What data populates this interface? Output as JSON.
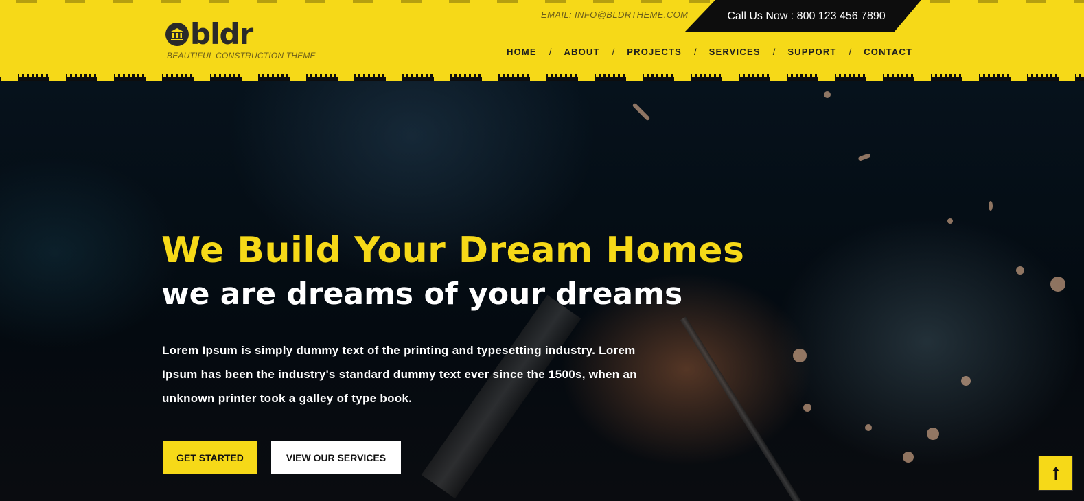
{
  "brand": {
    "name": "bldr",
    "tagline": "BEAUTIFUL CONSTRUCTION THEME",
    "icon": "bank-building-icon"
  },
  "topbar": {
    "email": "EMAIL: INFO@BLDRTHEME.COM",
    "call": "Call Us Now : 800 123 456 7890"
  },
  "nav": {
    "items": [
      "HOME",
      "ABOUT",
      "PROJECTS",
      "SERVICES",
      "SUPPORT",
      "CONTACT"
    ],
    "separator": "/"
  },
  "hero": {
    "title": "We Build Your Dream Homes",
    "subtitle": "we are dreams of your dreams",
    "text": "Lorem Ipsum is simply dummy text of the printing and typesetting industry. Lorem Ipsum has been the industry's standard dummy text ever since the 1500s, when an unknown printer took a galley of type book.",
    "primary_button": "GET STARTED",
    "secondary_button": "VIEW OUR SERVICES"
  },
  "scroll_top": {
    "icon": "arrow-up-icon"
  },
  "colors": {
    "accent": "#f6d918",
    "dark": "#0d0d0d",
    "text_light": "#ffffff"
  }
}
